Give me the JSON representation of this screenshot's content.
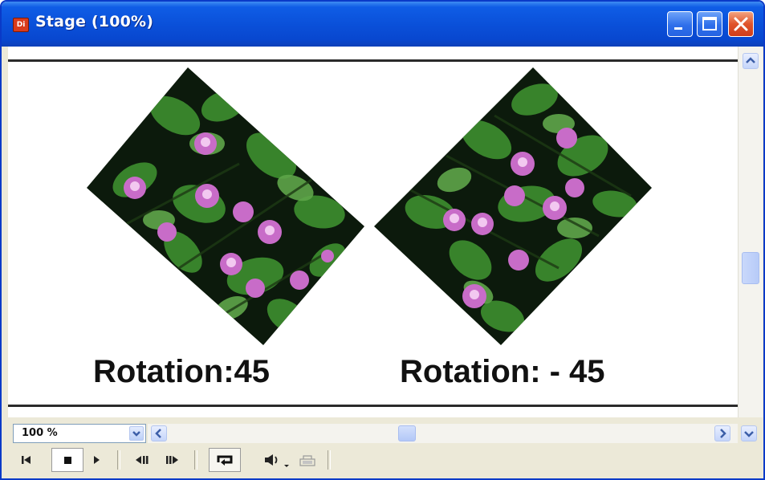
{
  "window": {
    "title": "Stage (100%)",
    "app_icon_label": "Di",
    "buttons": [
      "minimize",
      "maximize",
      "close"
    ]
  },
  "stage": {
    "background": "#ffffff",
    "images": [
      {
        "description_icon": "water-lily-photo",
        "rotation": 45
      },
      {
        "description_icon": "water-lily-photo",
        "rotation": -45
      }
    ],
    "captions": {
      "left": "Rotation:45",
      "right": "Rotation: - 45"
    }
  },
  "zoom": {
    "value": "100 %"
  },
  "playback": {
    "controls": [
      "rewind-icon",
      "stop-icon",
      "play-icon",
      "step-back-icon",
      "step-forward-icon",
      "loop-icon",
      "volume-icon",
      "volume-dropdown-icon",
      "lock-icon"
    ]
  },
  "colors": {
    "titlebar": "#0a4fd8",
    "close_button": "#e0542b",
    "chrome": "#ece9d8",
    "caption_text": "#111111"
  }
}
